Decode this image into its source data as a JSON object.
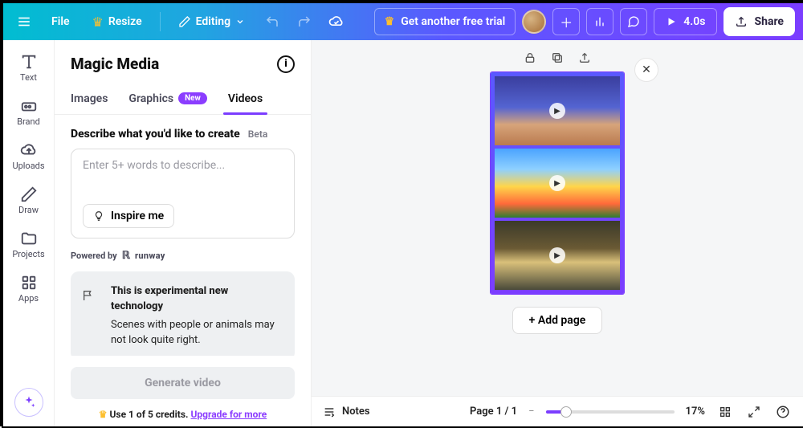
{
  "top": {
    "file": "File",
    "resize": "Resize",
    "editing": "Editing",
    "trial": "Get another free trial",
    "duration": "4.0s",
    "share": "Share"
  },
  "rail": {
    "text": "Text",
    "brand": "Brand",
    "uploads": "Uploads",
    "draw": "Draw",
    "projects": "Projects",
    "apps": "Apps"
  },
  "panel": {
    "title": "Magic Media",
    "tabs": {
      "images": "Images",
      "graphics": "Graphics",
      "graphics_badge": "New",
      "videos": "Videos"
    },
    "describe": "Describe what you'd like to create",
    "beta": "Beta",
    "placeholder": "Enter 5+ words to describe...",
    "inspire": "Inspire me",
    "powered": "Powered by",
    "runway": "runway",
    "notice_title": "This is experimental new technology",
    "notice_body": "Scenes with people or animals may not look quite right.",
    "generate": "Generate video",
    "credits_a": "Use 1 of 5 credits.",
    "credits_b": "Upgrade for more"
  },
  "canvas": {
    "add_page": "+ Add page"
  },
  "status": {
    "notes": "Notes",
    "page": "Page 1 / 1",
    "zoom": "17%"
  }
}
